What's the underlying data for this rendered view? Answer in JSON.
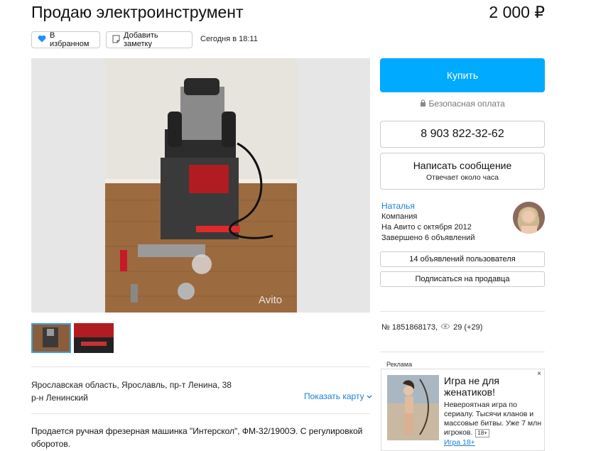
{
  "listing": {
    "title": "Продаю электроинструмент",
    "price": "2 000 ₽",
    "favorite_label": "В избранном",
    "add_note_label": "Добавить заметку",
    "date": "Сегодня в 18:11",
    "photo_watermark": "Avito"
  },
  "actions": {
    "buy_label": "Купить",
    "safe_payment": "Безопасная оплата",
    "phone": "8 903 822-32-62",
    "message_label": "Написать сообщение",
    "reply_time": "Отвечает около часа"
  },
  "seller": {
    "name": "Наталья",
    "type": "Компания",
    "since": "На Авито с октября 2012",
    "completed": "Завершено 6 объявлений",
    "listings_button": "14 объявлений пользователя",
    "subscribe_button": "Подписаться на продавца"
  },
  "stats": {
    "listing_id": "№ 1851868173,",
    "views": "29 (+29)"
  },
  "location": {
    "address": "Ярославская область, Ярославль, пр-т Ленина, 38",
    "district": "р-н Ленинский",
    "show_map": "Показать карту"
  },
  "description": "Продается ручная фрезерная машинка \"Интерскол\", ФМ-32/1900Э. С регулировкой оборотов.",
  "ad": {
    "label": "Реклама",
    "close": "×",
    "headline": "Игра не для женатиков!",
    "body": "Невероятная игра по сериалу. Тысячи кланов и массовые битвы. Уже 7 млн игроков.",
    "age": "18+",
    "link": "Игра 18+"
  },
  "colors": {
    "accent": "#00aaff",
    "link": "#1a7fd4",
    "favorite_heart": "#1e90ff"
  }
}
